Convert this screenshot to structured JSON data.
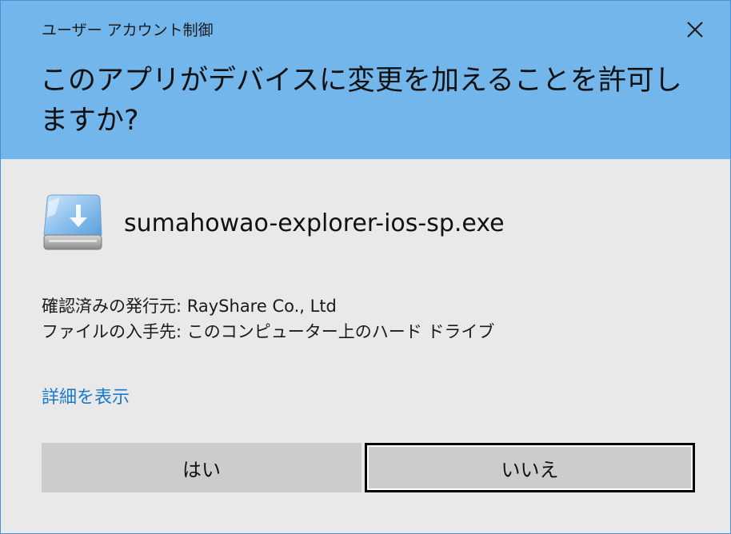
{
  "window": {
    "title": "ユーザー アカウント制御",
    "prompt": "このアプリがデバイスに変更を加えることを許可しますか?",
    "close_icon": "close-icon"
  },
  "file": {
    "icon": "drive-download-icon",
    "name": "sumahowao-explorer-ios-sp.exe"
  },
  "info": {
    "publisher": "確認済みの発行元: RayShare Co., Ltd",
    "origin": "ファイルの入手先: このコンピューター上のハード ドライブ"
  },
  "details_link": "詳細を表示",
  "buttons": {
    "yes": "はい",
    "no": "いいえ"
  },
  "colors": {
    "header": "#73b6ec",
    "body": "#e9e9e9",
    "link": "#1979ca",
    "button": "#cccccc"
  }
}
